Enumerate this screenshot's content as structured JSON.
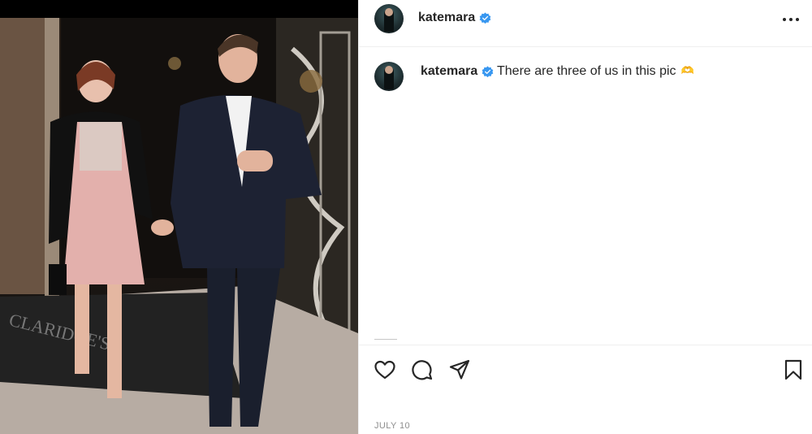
{
  "photo": {
    "alt_icon": "photo",
    "storefront_sign": "CLARIDGE'S"
  },
  "post": {
    "username": "katemara",
    "verified": true,
    "caption": {
      "username": "katemara",
      "text": "There are three of us in this pic",
      "emoji": "🫶"
    },
    "date": "JULY 10"
  },
  "icons": {
    "more": "more-horizontal-icon",
    "like": "heart-icon",
    "comment": "comment-bubble-icon",
    "share": "paper-plane-icon",
    "save": "bookmark-icon",
    "verified": "verified-badge-icon"
  },
  "colors": {
    "verified": "#3897f0",
    "text": "#262626",
    "muted": "#8e8e8e",
    "divider": "#efefef"
  }
}
